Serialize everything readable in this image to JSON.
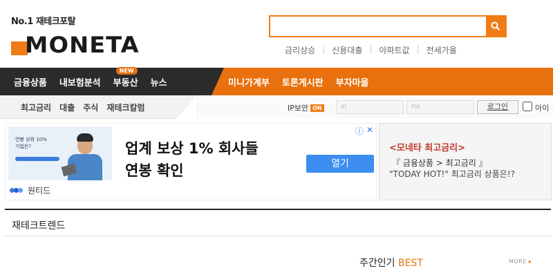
{
  "header": {
    "tagline": "No.1 재테크포탈",
    "logo_text": "MONETA",
    "search": {
      "value": "",
      "placeholder": ""
    },
    "keywords": [
      "금리상승",
      "신용대출",
      "아파트값",
      "전세가율"
    ]
  },
  "gnb": {
    "left_items": [
      "금융상품",
      "내보험분석",
      "부동산",
      "뉴스"
    ],
    "new_badge": "NEW",
    "right_items": [
      "미니가계부",
      "토론게시판",
      "부자마을"
    ]
  },
  "subnav": {
    "items": [
      "최고금리",
      "대출",
      "주식",
      "재테크칼럼"
    ],
    "ip_security_label": "IP보안",
    "ip_security_state": "ON",
    "id_placeholder": "ID",
    "pw_placeholder": "PW",
    "login_button": "로그인",
    "save_id_label": "아이"
  },
  "ad": {
    "thumb_text_1": "연봉 상위 10%",
    "thumb_text_2": "기업은?",
    "brand": "원티드",
    "headline_1": "업계 보상 1% 회사들",
    "headline_2": "연봉 확인",
    "open_button": "열기",
    "info_icon": "info-icon",
    "close_icon": "close-icon"
  },
  "promo": {
    "title": "<모네타 최고금리>",
    "line1": "『 금융상품 > 최고금리 』",
    "line2": "\"TODAY HOT!\" 최고금리 상품은!?"
  },
  "section": {
    "title": "재테크트렌드",
    "best_prefix": "주간인기",
    "best_highlight": "BEST",
    "more": "MORE"
  },
  "colors": {
    "accent": "#e8700e",
    "dark": "#2b2b2b",
    "link_blue": "#3d8df0"
  }
}
